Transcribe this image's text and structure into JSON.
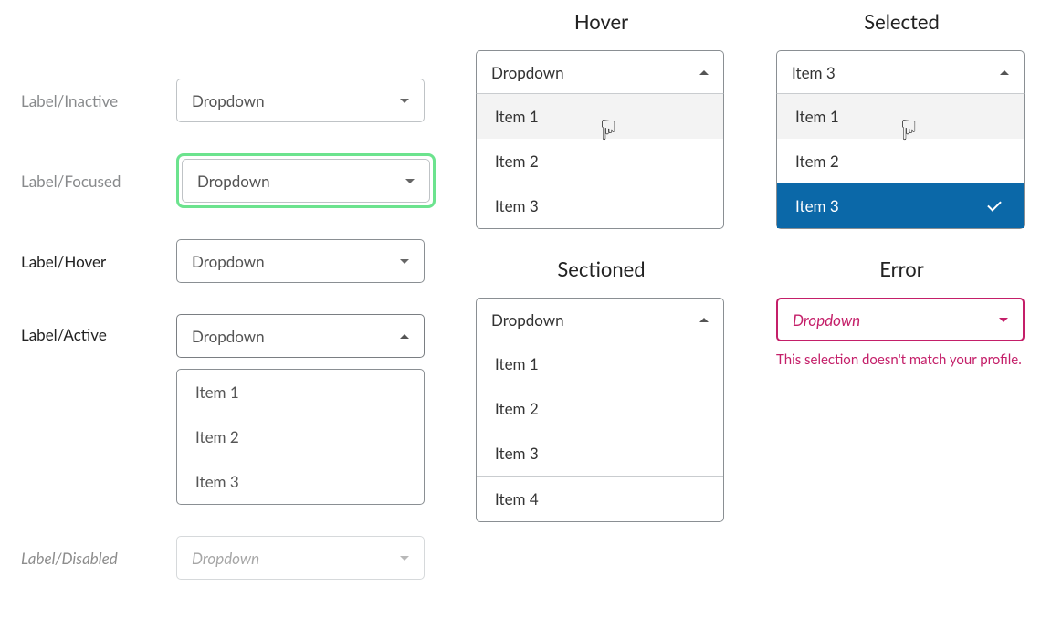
{
  "left": {
    "inactive": {
      "label": "Label/Inactive",
      "value": "Dropdown"
    },
    "focused": {
      "label": "Label/Focused",
      "value": "Dropdown"
    },
    "hover": {
      "label": "Label/Hover",
      "value": "Dropdown"
    },
    "active": {
      "label": "Label/Active",
      "value": "Dropdown",
      "items": [
        "Item 1",
        "Item 2",
        "Item 3"
      ]
    },
    "disabled": {
      "label": "Label/Disabled",
      "value": "Dropdown"
    }
  },
  "hover": {
    "title": "Hover",
    "value": "Dropdown",
    "items": [
      "Item 1",
      "Item 2",
      "Item 3"
    ]
  },
  "sectioned": {
    "title": "Sectioned",
    "value": "Dropdown",
    "section1": [
      "Item 1",
      "Item 2",
      "Item 3"
    ],
    "section2": [
      "Item 4"
    ]
  },
  "selected": {
    "title": "Selected",
    "value": "Item 3",
    "items": [
      "Item 1",
      "Item 2",
      "Item 3"
    ]
  },
  "error": {
    "title": "Error",
    "value": "Dropdown",
    "message": "This selection doesn't match your profile."
  }
}
